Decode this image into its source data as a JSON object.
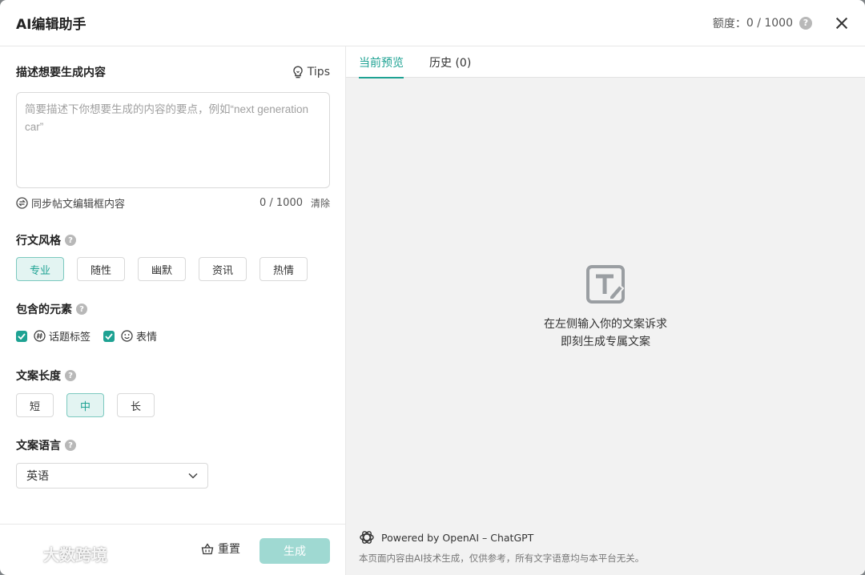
{
  "header": {
    "title": "AI编辑助手",
    "quota_label": "额度：",
    "quota_value": "0 / 1000",
    "help_mark": "?"
  },
  "left": {
    "desc_title": "描述想要生成内容",
    "tips_label": "Tips",
    "textarea_placeholder": "简要描述下你想要生成的内容的要点，例如“next generation car”",
    "sync_label": "同步帖文编辑框内容",
    "counter": "0 / 1000",
    "clear_label": "清除",
    "style_title": "行文风格",
    "styles": [
      "专业",
      "随性",
      "幽默",
      "资讯",
      "热情"
    ],
    "selected_style": "专业",
    "elements_title": "包含的元素",
    "elements": [
      "话题标签",
      "表情"
    ],
    "length_title": "文案长度",
    "lengths": [
      "短",
      "中",
      "长"
    ],
    "selected_length": "中",
    "language_title": "文案语言",
    "language_value": "英语",
    "reset_label": "重置",
    "generate_label": "生成",
    "watermark": "大数跨境"
  },
  "right": {
    "tabs": [
      "当前预览",
      "历史 (0)"
    ],
    "empty_line1": "在左侧输入你的文案诉求",
    "empty_line2": "即刻生成专属文案",
    "powered": "Powered by OpenAI – ChatGPT",
    "disclaimer": "本页面内容由AI技术生成，仅供参考，所有文字语意均与本平台无关。"
  },
  "colors": {
    "accent": "#1ea293",
    "accent_light": "#e3f4f2",
    "generate_disabled": "#9fd9d2"
  },
  "icons": [
    "help-icon",
    "close-icon",
    "lightbulb-icon",
    "sync-icon",
    "hashtag-icon",
    "smiley-icon",
    "chevron-down-icon",
    "basket-icon",
    "text-edit-icon",
    "openai-icon",
    "watermark-logo-icon"
  ]
}
